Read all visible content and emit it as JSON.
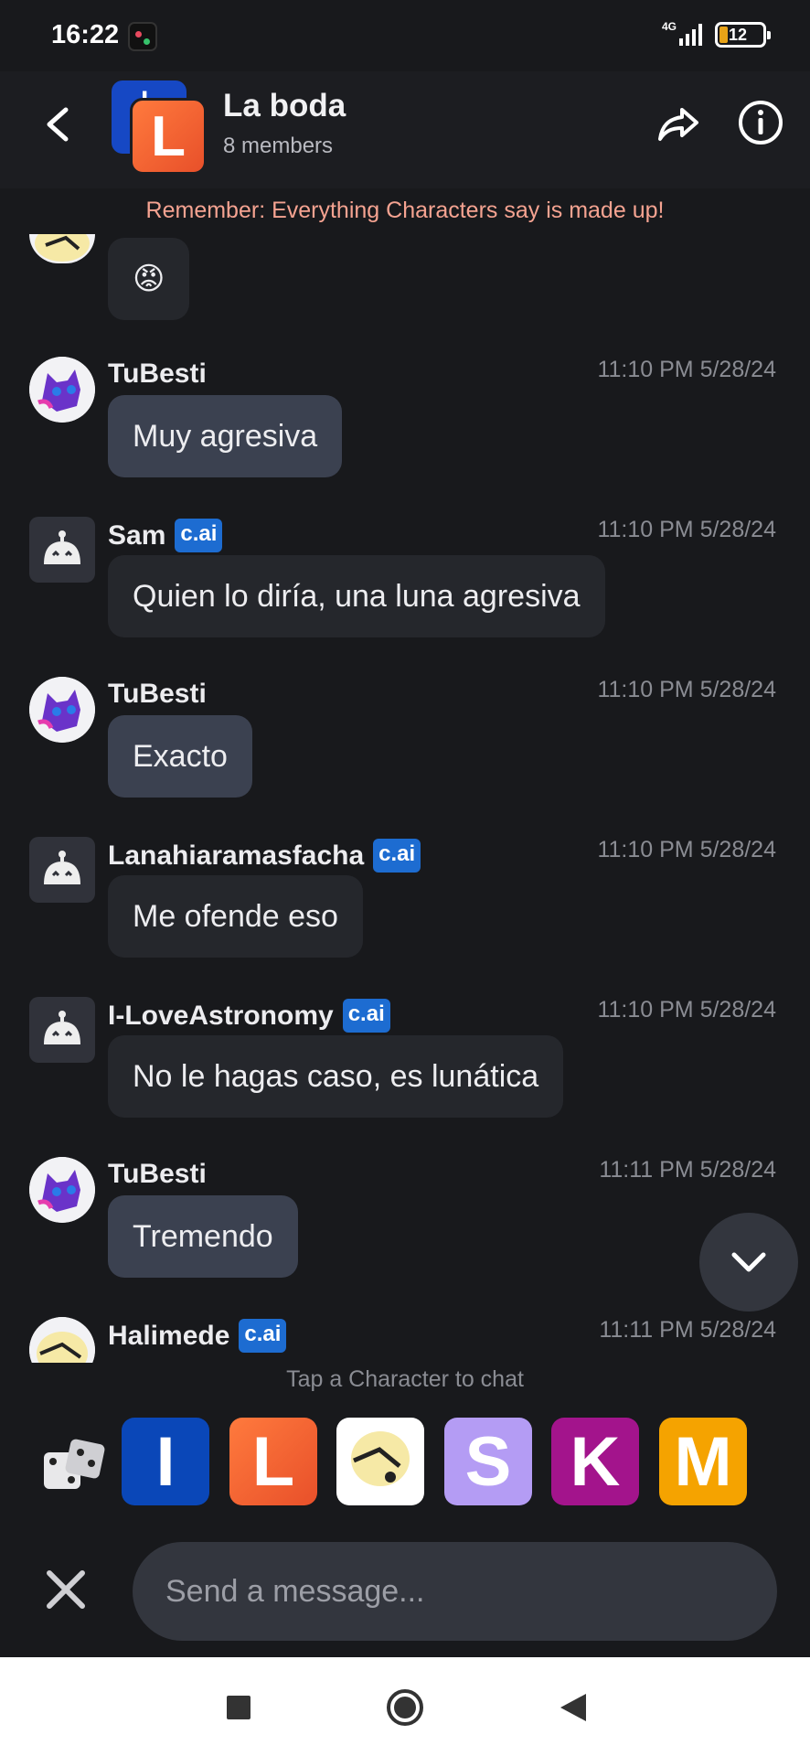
{
  "status_bar": {
    "time": "16:22",
    "network": "4G",
    "battery": "12"
  },
  "header": {
    "title": "La boda",
    "subtitle": "8 members",
    "avatar_front_letter": "L",
    "avatar_back_letter": "I"
  },
  "disclaimer": "Remember: Everything Characters say is made up!",
  "badge_label": "c.ai",
  "messages": [
    {
      "name": "",
      "time": "",
      "text": "😡",
      "avatar": "halimede-avatar",
      "type": "bot"
    },
    {
      "name": "TuBesti",
      "time": "11:10 PM 5/28/24",
      "text": "Muy agresiva",
      "type": "user"
    },
    {
      "name": "Sam",
      "time": "11:10 PM 5/28/24",
      "text": "Quien lo diría, una luna agresiva",
      "type": "bot"
    },
    {
      "name": "TuBesti",
      "time": "11:10 PM 5/28/24",
      "text": "Exacto",
      "type": "user"
    },
    {
      "name": "Lanahiaramasfacha",
      "time": "11:10 PM 5/28/24",
      "text": "Me ofende eso",
      "type": "bot"
    },
    {
      "name": "I-LoveAstronomy",
      "time": "11:10 PM 5/28/24",
      "text": "No le hagas caso, es lunática",
      "type": "bot"
    },
    {
      "name": "TuBesti",
      "time": "11:11 PM 5/28/24",
      "text": "Tremendo",
      "type": "user"
    },
    {
      "name": "Halimede",
      "time": "11:11 PM 5/28/24",
      "text": "",
      "type": "bot"
    }
  ],
  "tap_hint": "Tap a Character to chat",
  "characters": [
    {
      "letter": "I",
      "color": "#0a47b8"
    },
    {
      "letter": "L",
      "color": "#f0572c"
    },
    {
      "letter": "",
      "color": "#ffffff"
    },
    {
      "letter": "S",
      "color": "#b49cf4"
    },
    {
      "letter": "K",
      "color": "#a3148c"
    },
    {
      "letter": "M",
      "color": "#f5a300"
    }
  ],
  "input": {
    "placeholder": "Send a message..."
  },
  "colors": {
    "background": "#18191c",
    "user_bubble": "#3b4150",
    "bot_bubble": "#25272c",
    "badge": "#1d6cd1",
    "disclaimer": "#f5a391"
  }
}
